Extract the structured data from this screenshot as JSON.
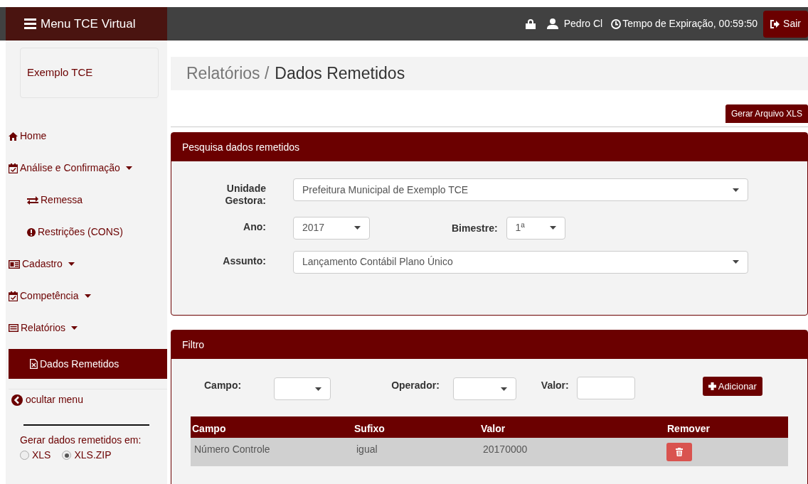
{
  "navbar": {
    "menu_button": "Menu TCE Virtual",
    "user": "Pedro Cl",
    "expiration": "Tempo de Expiração, 00:59:50",
    "logout": "Sair"
  },
  "sidebar": {
    "org": "Exemplo TCE",
    "items": [
      {
        "kind": "home",
        "label": "Home",
        "has_menu": false,
        "selected": false
      },
      {
        "kind": "calendar",
        "label": "Análise e Confirmação",
        "has_menu": true,
        "selected": false,
        "children": [
          {
            "kind": "exchange",
            "label": "Remessa",
            "has_menu": false,
            "selected": false
          },
          {
            "kind": "alert",
            "label": "Restrições (CONS)",
            "has_menu": false,
            "selected": false
          }
        ]
      },
      {
        "kind": "idcard",
        "label": "Cadastro",
        "has_menu": true,
        "selected": false
      },
      {
        "kind": "calendar",
        "label": "Competência",
        "has_menu": true,
        "selected": false
      },
      {
        "kind": "list",
        "label": "Relatórios",
        "has_menu": true,
        "selected": false,
        "children": [
          {
            "kind": "file",
            "label": "Dados Remetidos",
            "has_menu": false,
            "selected": true
          }
        ]
      }
    ],
    "hide_menu": "ocultar menu",
    "export": {
      "label": "Gerar dados remetidos em:",
      "options": [
        {
          "label": "XLS",
          "selected": false
        },
        {
          "label": "XLS.ZIP",
          "selected": true
        }
      ]
    }
  },
  "breadcrumb": {
    "parent": "Relatórios /",
    "current": "Dados Remetidos"
  },
  "generate_button": "Gerar Arquivo XLS",
  "search_panel": {
    "title": "Pesquisa dados remetidos",
    "unit": {
      "label": "Unidade Gestora:",
      "value": "Prefeitura Municipal de Exemplo TCE"
    },
    "year": {
      "label": "Ano:",
      "value": "2017"
    },
    "bimester": {
      "label": "Bimestre:",
      "value": "1ª"
    },
    "subject": {
      "label": "Assunto:",
      "value": "Lançamento Contábil Plano Único"
    }
  },
  "filter_panel": {
    "title": "Filtro",
    "field_label": "Campo:",
    "operator_label": "Operador:",
    "value_label": "Valor:",
    "add_button": "Adicionar",
    "table": {
      "columns": [
        "Campo",
        "Sufixo",
        "Valor",
        "Remover"
      ],
      "rows": [
        [
          "Número Controle",
          "igual",
          "20170000"
        ]
      ]
    }
  }
}
